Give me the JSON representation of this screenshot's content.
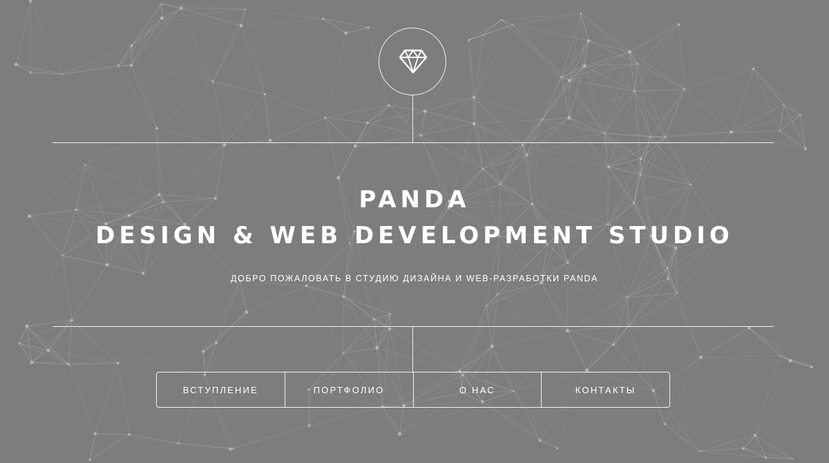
{
  "colors": {
    "background": "#7d7d7f",
    "foreground": "#ffffff",
    "network": "#c4c4c6"
  },
  "logo": {
    "icon": "diamond-icon"
  },
  "header": {
    "title_line1": "PANDA",
    "title_line2": "DESIGN & WEB DEVELOPMENT STUDIO",
    "tagline": "ДОБРО ПОЖАЛОВАТЬ В СТУДИЮ ДИЗАЙНА И WEB-РАЗРАБОТКИ PANDA"
  },
  "nav": {
    "items": [
      {
        "label": "ВСТУПЛЕНИЕ"
      },
      {
        "label": "ПОРТФОЛИО"
      },
      {
        "label": "О НАС"
      },
      {
        "label": "КОНТАКТЫ"
      }
    ]
  }
}
